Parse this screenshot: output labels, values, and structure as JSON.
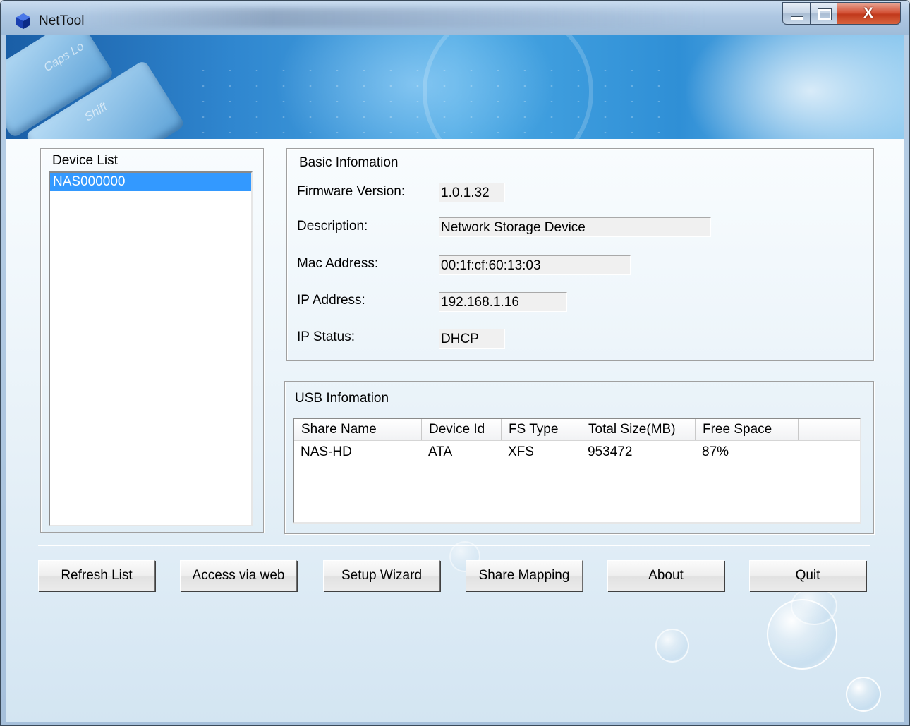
{
  "window": {
    "title": "NetTool",
    "close_glyph": "X"
  },
  "banner": {
    "caps_key": "Caps Lo",
    "shift_key": "Shift"
  },
  "device_list": {
    "caption": "Device List",
    "items": [
      "NAS000000"
    ],
    "selected": "NAS000000"
  },
  "basic_info": {
    "caption": "Basic Infomation",
    "firmware_label": "Firmware Version:",
    "firmware_value": "1.0.1.32",
    "description_label": "Description:",
    "description_value": "Network Storage Device",
    "mac_label": "Mac Address:",
    "mac_value": "00:1f:cf:60:13:03",
    "ip_label": "IP Address:",
    "ip_value": "192.168.1.16",
    "status_label": "IP Status:",
    "status_value": "DHCP"
  },
  "usb_info": {
    "caption": "USB Infomation",
    "columns": [
      "Share Name",
      "Device Id",
      "FS Type",
      "Total Size(MB)",
      "Free Space"
    ],
    "rows": [
      [
        "NAS-HD",
        "ATA",
        "XFS",
        "953472",
        "87%"
      ]
    ]
  },
  "buttons": {
    "refresh": "Refresh List",
    "web": "Access via web",
    "wizard": "Setup Wizard",
    "mapping": "Share Mapping",
    "about": "About",
    "quit": "Quit"
  },
  "icons": {
    "app": "blue-cube-icon",
    "minimize": "minimize-icon",
    "maximize": "maximize-icon",
    "close": "close-icon"
  },
  "colors": {
    "selection": "#3399ff",
    "banner": "#2f86cf",
    "close_button": "#c1391c"
  }
}
